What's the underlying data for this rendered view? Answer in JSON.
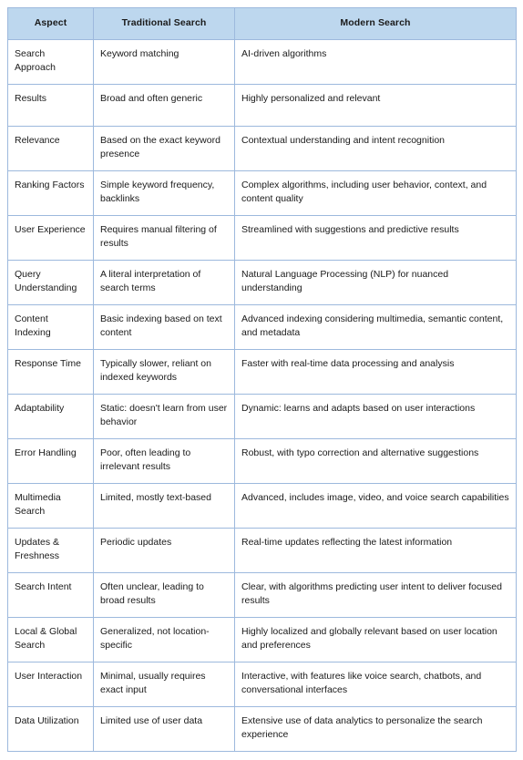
{
  "table": {
    "columns": [
      "Aspect",
      "Traditional Search",
      "Modern Search"
    ],
    "rows": [
      {
        "aspect": "Search Approach",
        "traditional": "Keyword matching",
        "modern": "AI-driven algorithms"
      },
      {
        "aspect": "Results",
        "traditional": "Broad and often generic",
        "modern": "Highly personalized and relevant"
      },
      {
        "aspect": "Relevance",
        "traditional": "Based on the exact keyword presence",
        "modern": "Contextual understanding and intent recognition"
      },
      {
        "aspect": "Ranking Factors",
        "traditional": "Simple keyword frequency, backlinks",
        "modern": "Complex algorithms, including user behavior, context, and content quality"
      },
      {
        "aspect": "User Experience",
        "traditional": "Requires manual filtering of results",
        "modern": "Streamlined with suggestions and predictive results"
      },
      {
        "aspect": "Query Understanding",
        "traditional": "A literal interpretation of search terms",
        "modern": "Natural Language Processing (NLP) for nuanced understanding"
      },
      {
        "aspect": "Content Indexing",
        "traditional": "Basic indexing based on text content",
        "modern": "Advanced indexing considering multimedia, semantic content, and metadata"
      },
      {
        "aspect": "Response Time",
        "traditional": "Typically slower, reliant on indexed keywords",
        "modern": "Faster with real-time data processing and analysis"
      },
      {
        "aspect": "Adaptability",
        "traditional": "Static: doesn't learn from user behavior",
        "modern": "Dynamic: learns and adapts based on user interactions"
      },
      {
        "aspect": "Error Handling",
        "traditional": "Poor, often leading to irrelevant results",
        "modern": "Robust, with typo correction and alternative suggestions"
      },
      {
        "aspect": "Multimedia Search",
        "traditional": "Limited, mostly text-based",
        "modern": "Advanced, includes image, video, and voice search capabilities"
      },
      {
        "aspect": "Updates & Freshness",
        "traditional": "Periodic updates",
        "modern": "Real-time updates reflecting the latest information"
      },
      {
        "aspect": "Search Intent",
        "traditional": "Often unclear, leading to broad results",
        "modern": "Clear, with algorithms predicting user intent to deliver focused results"
      },
      {
        "aspect": "Local & Global Search",
        "traditional": "Generalized, not location-specific",
        "modern": "Highly localized and globally relevant based on user location and preferences"
      },
      {
        "aspect": "User Interaction",
        "traditional": "Minimal, usually requires exact input",
        "modern": "Interactive, with features like voice search, chatbots, and conversational interfaces"
      },
      {
        "aspect": "Data Utilization",
        "traditional": "Limited use of user data",
        "modern": "Extensive use of data analytics to personalize the search experience"
      }
    ]
  },
  "colors": {
    "header_background": "#bdd7ee",
    "border": "#9db9dd",
    "text": "#1a1a1a",
    "cell_background": "#ffffff"
  }
}
